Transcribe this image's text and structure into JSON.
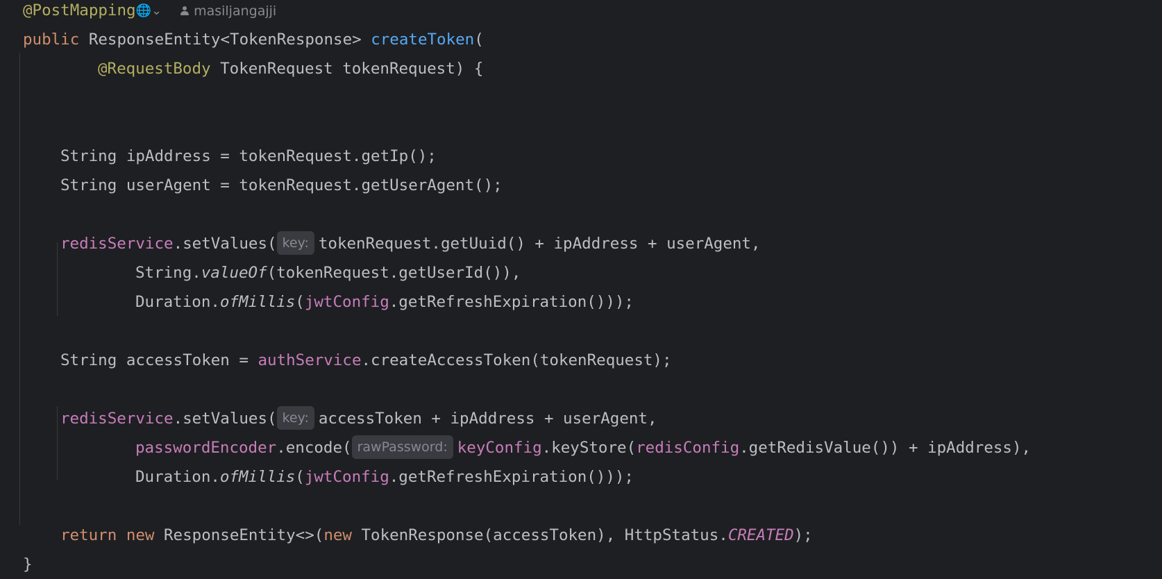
{
  "editor": {
    "author": "masiljangajji",
    "hint_key": "key:",
    "hint_raw_password": "rawPassword:",
    "lines": {
      "l1_annotation": "@PostMapping",
      "l2_kw_public": "public",
      "l2_type": " ResponseEntity<TokenResponse> ",
      "l2_method": "createToken",
      "l2_paren": "(",
      "l3_annotation": "@RequestBody",
      "l3_rest": " TokenRequest tokenRequest) {",
      "l4": "String ipAddress = tokenRequest.getIp();",
      "l5": "String userAgent = tokenRequest.getUserAgent();",
      "l6_field": "redisService",
      "l6_call": ".setValues(",
      "l6_rest": "tokenRequest.getUuid() + ipAddress + userAgent,",
      "l7_a": "String.",
      "l7_it": "valueOf",
      "l7_b": "(tokenRequest.getUserId()),",
      "l8_a": "Duration.",
      "l8_it": "ofMillis",
      "l8_b": "(",
      "l8_field": "jwtConfig",
      "l8_c": ".getRefreshExpiration()));",
      "l9_a": "String accessToken = ",
      "l9_field": "authService",
      "l9_b": ".createAccessToken(tokenRequest);",
      "l10_field": "redisService",
      "l10_call": ".setValues(",
      "l10_rest": "accessToken + ipAddress + userAgent,",
      "l11_field": "passwordEncoder",
      "l11_call": ".encode(",
      "l11_field2": "keyConfig",
      "l11_mid": ".keyStore(",
      "l11_field3": "redisConfig",
      "l11_end": ".getRedisValue()) + ipAddress),",
      "l12_a": "Duration.",
      "l12_it": "ofMillis",
      "l12_b": "(",
      "l12_field": "jwtConfig",
      "l12_c": ".getRefreshExpiration()));",
      "l13_kw_return": "return",
      "l13_kw_new": "new",
      "l13_a": " ResponseEntity<>(",
      "l13_kw_new2": "new",
      "l13_b": " TokenResponse(accessToken), HttpStatus.",
      "l13_const": "CREATED",
      "l13_c": ");",
      "l14": "}"
    }
  }
}
